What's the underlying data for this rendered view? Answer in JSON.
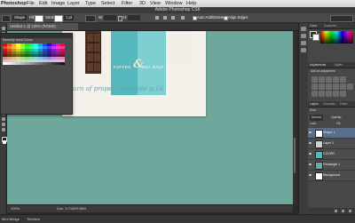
{
  "menubar": {
    "items": [
      "Photoshop",
      "File",
      "Edit",
      "Image",
      "Layer",
      "Type",
      "Select",
      "Filter",
      "3D",
      "View",
      "Window",
      "Help"
    ]
  },
  "window": {
    "title": "Adobe Photoshop CS6"
  },
  "options_bar": {
    "shape_label": "Shape",
    "fill_label": "Fill:",
    "stroke_label": "Stroke:",
    "stroke_width": "1 pt",
    "w_label": "W:",
    "h_label": "H:",
    "auto_add_delete": "Auto Add/Delete",
    "align_edges": "Align Edges"
  },
  "document": {
    "tab": "Untitled-1 @ 100% (RGB/8)",
    "status_doc": "Doc: 3.71M/9.08M",
    "zoom": "100%"
  },
  "artwork": {
    "brand_left": "TOFFEE",
    "brand_right": "SEA SALT",
    "ampersand": "&",
    "tagline": "the return of proper chocolate p.16"
  },
  "swatches_panel": {
    "title": "Recently Used Colors"
  },
  "panels": {
    "color_tab": "Color",
    "swatches_tab": "Swatches",
    "adjustments_tab": "Adjustments",
    "styles_tab": "Styles",
    "adjustments_hint": "Add an adjustment",
    "layers_tab": "Layers",
    "channels_tab": "Channels",
    "paths_tab": "Paths",
    "kind_label": "Kind",
    "blend_mode": "Normal",
    "opacity_label": "Opacity:",
    "lock_label": "Lock:",
    "fill_label": "Fill:",
    "layers": [
      {
        "name": "Shape 1",
        "selected": true,
        "thumb_color": "#ffffff"
      },
      {
        "name": "Layer 1",
        "selected": false,
        "thumb_color": "#cfcfcf"
      },
      {
        "name": "COVER",
        "selected": false,
        "thumb_color": "#55b8bd"
      },
      {
        "name": "Rectangle 1",
        "selected": false,
        "thumb_color": "#6ea89d"
      },
      {
        "name": "Background",
        "selected": false,
        "thumb_color": "#ffffff"
      }
    ]
  },
  "bottom": {
    "mini_bridge": "Mini Bridge",
    "timeline": "Timeline"
  },
  "colors": {
    "canvas_bg": "#6ea89d",
    "pack_teal": "#55b8bd",
    "chocolate": "#4b3126",
    "selection_blue": "#5a6e8c"
  }
}
